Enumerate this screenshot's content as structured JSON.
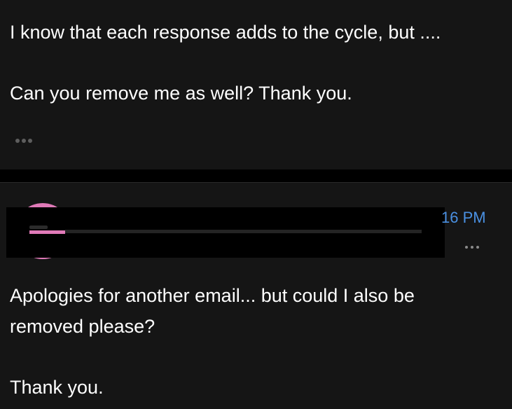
{
  "messages": [
    {
      "body_lines": [
        "I know that each response adds to the cycle, but ....",
        "Can you remove me as well? Thank you."
      ],
      "more_icon": "ellipsis-icon"
    },
    {
      "sender": {
        "avatar_color": "#e07ab8",
        "name_redacted": true
      },
      "timestamp": "16 PM",
      "body_lines": [
        "Apologies for another email... but could I also be",
        "removed please?",
        "Thank you."
      ],
      "more_icon": "ellipsis-icon"
    }
  ],
  "colors": {
    "background": "#000000",
    "message_background": "#151515",
    "text": "#ffffff",
    "timestamp": "#4a90e2",
    "avatar": "#e07ab8"
  }
}
